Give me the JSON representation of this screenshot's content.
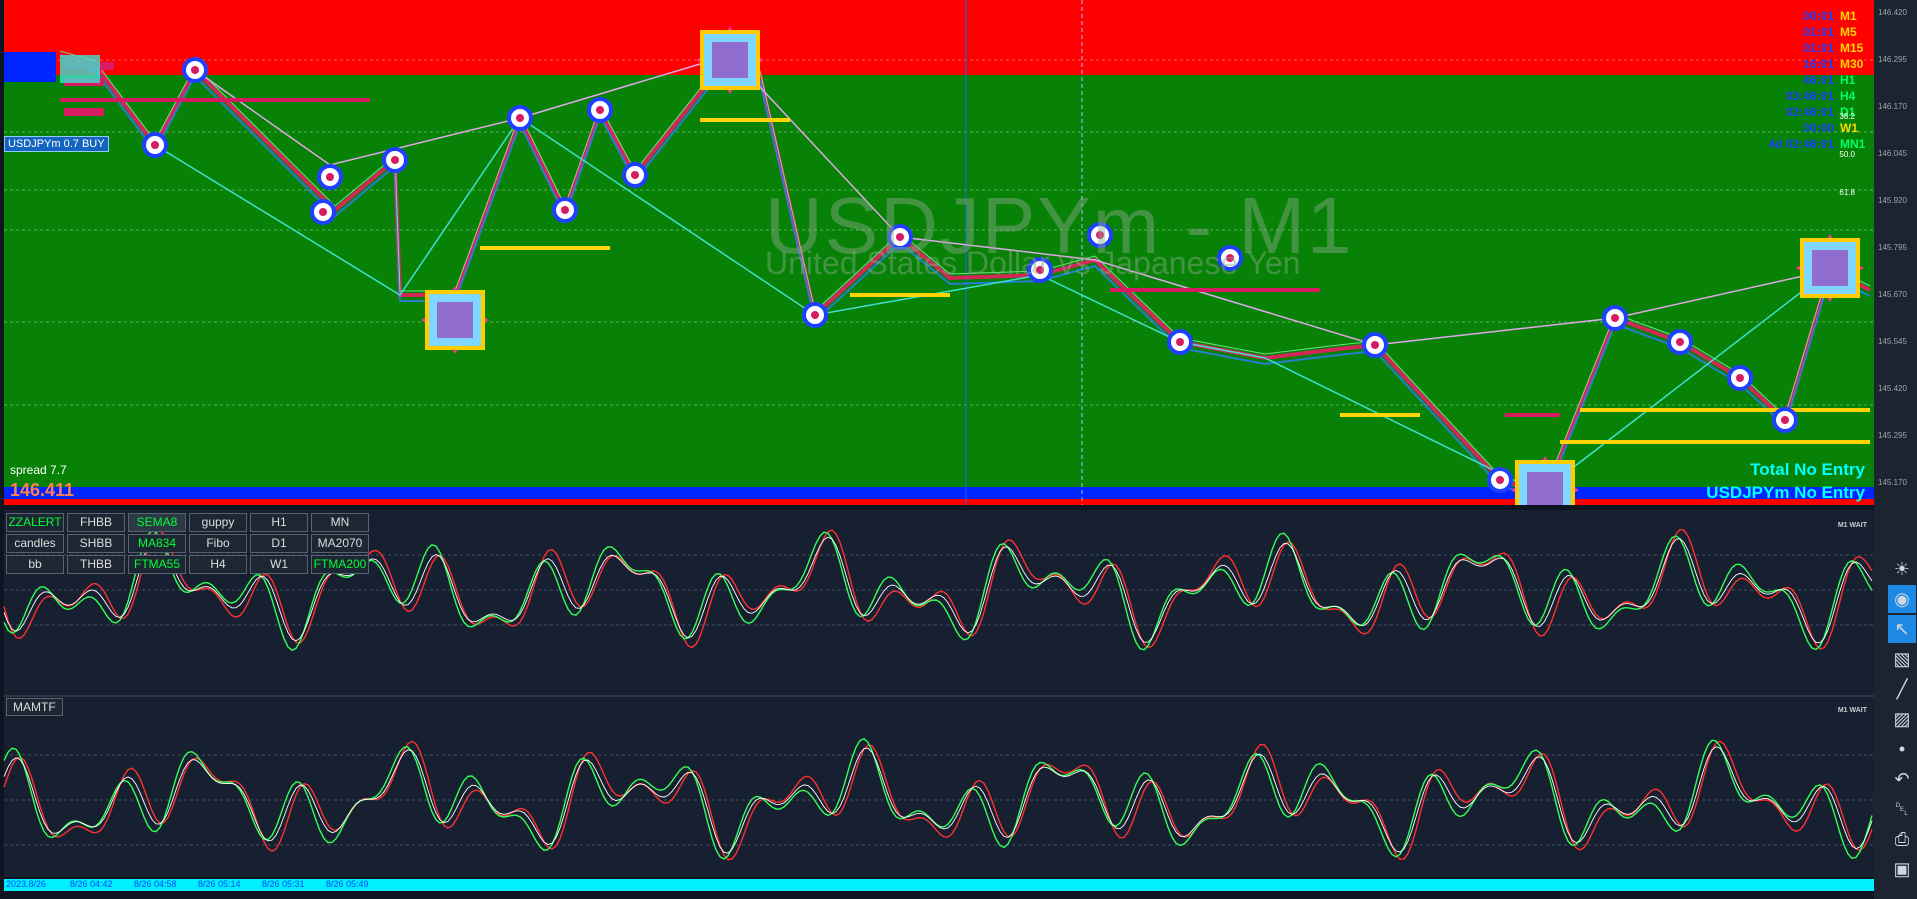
{
  "chart": {
    "symbol_watermark": "USDJPYm - M1",
    "description_watermark": "United States Dollar vs Japanese Yen",
    "buy_badge": "USDJPYm 0.7 BUY",
    "spread": "spread 7.7",
    "price": "146.411",
    "total_entry": "Total No Entry",
    "symbol_entry": "USDJPYm No Entry",
    "colors": {
      "zone_red": "#ff0000",
      "zone_green": "#078207",
      "zone_blue": "#0024ff",
      "line_pink": "#e91e63",
      "line_cyan": "#40e0d0",
      "accent_cyan": "#00ffff",
      "price_orange": "#ff7f50"
    }
  },
  "timeframes": [
    {
      "time": "00:01",
      "tf": "M1",
      "color": "#ffd700"
    },
    {
      "time": "01:01",
      "tf": "M5",
      "color": "#ffd700"
    },
    {
      "time": "01:01",
      "tf": "M15",
      "color": "#ffd700"
    },
    {
      "time": "16:01",
      "tf": "M30",
      "color": "#ffd700"
    },
    {
      "time": "46:01",
      "tf": "H1",
      "color": "#00ff66"
    },
    {
      "time": "03:46:01",
      "tf": "H4",
      "color": "#00ff66"
    },
    {
      "time": "02:46:01",
      "tf": "D1",
      "color": "#00ff66"
    },
    {
      "time": "00:00",
      "tf": "W1",
      "color": "#ffd700"
    },
    {
      "time": "4d 02:46:01",
      "tf": "MN1",
      "color": "#00ff66"
    }
  ],
  "price_axis": [
    "146.420",
    "146.295",
    "146.170",
    "146.045",
    "145.920",
    "145.795",
    "145.670",
    "145.545",
    "145.420",
    "145.295",
    "145.170"
  ],
  "fibo_levels": [
    "38.2",
    "50.0",
    "61.8"
  ],
  "buttons": [
    {
      "label": "ZZALERT",
      "style": "green"
    },
    {
      "label": "FHBB",
      "style": ""
    },
    {
      "label": "SEMA8",
      "style": "green on"
    },
    {
      "label": "guppy",
      "style": ""
    },
    {
      "label": "H1",
      "style": ""
    },
    {
      "label": "MN",
      "style": ""
    },
    {
      "label": "candles",
      "style": ""
    },
    {
      "label": "SHBB",
      "style": ""
    },
    {
      "label": "MA834",
      "style": "green"
    },
    {
      "label": "Fibo",
      "style": ""
    },
    {
      "label": "D1",
      "style": ""
    },
    {
      "label": "MA2070",
      "style": ""
    },
    {
      "label": "bb",
      "style": ""
    },
    {
      "label": "THBB",
      "style": ""
    },
    {
      "label": "FTMA55",
      "style": "green"
    },
    {
      "label": "H4",
      "style": ""
    },
    {
      "label": "W1",
      "style": ""
    },
    {
      "label": "FTMA200",
      "style": "green"
    }
  ],
  "osc2_label": "MAMTF",
  "wait_label": "M1 WAIT",
  "time_axis": [
    "2023.8/26",
    "8/26 04:42",
    "8/26 04:58",
    "8/26 05:14",
    "8/26 05:31",
    "8/26 05:49"
  ],
  "toolbar": [
    "lightbulb-icon",
    "eye-icon",
    "cursor-icon",
    "eraser-icon",
    "line-icon",
    "ruler-icon",
    "dot-icon",
    "undo-icon",
    "trash-icon",
    "print-icon",
    "camera-icon"
  ]
}
